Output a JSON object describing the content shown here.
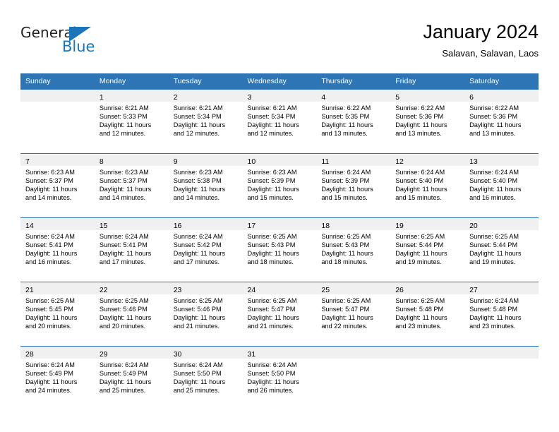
{
  "brand": {
    "name_top": "General",
    "name_bottom": "Blue",
    "triangle_color": "#1b75bb",
    "text_color": "#231f20"
  },
  "header": {
    "title": "January 2024",
    "subtitle": "Salavan, Salavan, Laos"
  },
  "theme": {
    "header_blue": "#2e75b6",
    "daynum_band": "#f0f0f0",
    "text": "#000000"
  },
  "weekdays": [
    "Sunday",
    "Monday",
    "Tuesday",
    "Wednesday",
    "Thursday",
    "Friday",
    "Saturday"
  ],
  "weeks": [
    [
      {
        "day": "",
        "sunrise": "",
        "sunset": "",
        "daylight1": "",
        "daylight2": ""
      },
      {
        "day": "1",
        "sunrise": "Sunrise: 6:21 AM",
        "sunset": "Sunset: 5:33 PM",
        "daylight1": "Daylight: 11 hours",
        "daylight2": "and 12 minutes."
      },
      {
        "day": "2",
        "sunrise": "Sunrise: 6:21 AM",
        "sunset": "Sunset: 5:34 PM",
        "daylight1": "Daylight: 11 hours",
        "daylight2": "and 12 minutes."
      },
      {
        "day": "3",
        "sunrise": "Sunrise: 6:21 AM",
        "sunset": "Sunset: 5:34 PM",
        "daylight1": "Daylight: 11 hours",
        "daylight2": "and 12 minutes."
      },
      {
        "day": "4",
        "sunrise": "Sunrise: 6:22 AM",
        "sunset": "Sunset: 5:35 PM",
        "daylight1": "Daylight: 11 hours",
        "daylight2": "and 13 minutes."
      },
      {
        "day": "5",
        "sunrise": "Sunrise: 6:22 AM",
        "sunset": "Sunset: 5:36 PM",
        "daylight1": "Daylight: 11 hours",
        "daylight2": "and 13 minutes."
      },
      {
        "day": "6",
        "sunrise": "Sunrise: 6:22 AM",
        "sunset": "Sunset: 5:36 PM",
        "daylight1": "Daylight: 11 hours",
        "daylight2": "and 13 minutes."
      }
    ],
    [
      {
        "day": "7",
        "sunrise": "Sunrise: 6:23 AM",
        "sunset": "Sunset: 5:37 PM",
        "daylight1": "Daylight: 11 hours",
        "daylight2": "and 14 minutes."
      },
      {
        "day": "8",
        "sunrise": "Sunrise: 6:23 AM",
        "sunset": "Sunset: 5:37 PM",
        "daylight1": "Daylight: 11 hours",
        "daylight2": "and 14 minutes."
      },
      {
        "day": "9",
        "sunrise": "Sunrise: 6:23 AM",
        "sunset": "Sunset: 5:38 PM",
        "daylight1": "Daylight: 11 hours",
        "daylight2": "and 14 minutes."
      },
      {
        "day": "10",
        "sunrise": "Sunrise: 6:23 AM",
        "sunset": "Sunset: 5:39 PM",
        "daylight1": "Daylight: 11 hours",
        "daylight2": "and 15 minutes."
      },
      {
        "day": "11",
        "sunrise": "Sunrise: 6:24 AM",
        "sunset": "Sunset: 5:39 PM",
        "daylight1": "Daylight: 11 hours",
        "daylight2": "and 15 minutes."
      },
      {
        "day": "12",
        "sunrise": "Sunrise: 6:24 AM",
        "sunset": "Sunset: 5:40 PM",
        "daylight1": "Daylight: 11 hours",
        "daylight2": "and 15 minutes."
      },
      {
        "day": "13",
        "sunrise": "Sunrise: 6:24 AM",
        "sunset": "Sunset: 5:40 PM",
        "daylight1": "Daylight: 11 hours",
        "daylight2": "and 16 minutes."
      }
    ],
    [
      {
        "day": "14",
        "sunrise": "Sunrise: 6:24 AM",
        "sunset": "Sunset: 5:41 PM",
        "daylight1": "Daylight: 11 hours",
        "daylight2": "and 16 minutes."
      },
      {
        "day": "15",
        "sunrise": "Sunrise: 6:24 AM",
        "sunset": "Sunset: 5:41 PM",
        "daylight1": "Daylight: 11 hours",
        "daylight2": "and 17 minutes."
      },
      {
        "day": "16",
        "sunrise": "Sunrise: 6:24 AM",
        "sunset": "Sunset: 5:42 PM",
        "daylight1": "Daylight: 11 hours",
        "daylight2": "and 17 minutes."
      },
      {
        "day": "17",
        "sunrise": "Sunrise: 6:25 AM",
        "sunset": "Sunset: 5:43 PM",
        "daylight1": "Daylight: 11 hours",
        "daylight2": "and 18 minutes."
      },
      {
        "day": "18",
        "sunrise": "Sunrise: 6:25 AM",
        "sunset": "Sunset: 5:43 PM",
        "daylight1": "Daylight: 11 hours",
        "daylight2": "and 18 minutes."
      },
      {
        "day": "19",
        "sunrise": "Sunrise: 6:25 AM",
        "sunset": "Sunset: 5:44 PM",
        "daylight1": "Daylight: 11 hours",
        "daylight2": "and 19 minutes."
      },
      {
        "day": "20",
        "sunrise": "Sunrise: 6:25 AM",
        "sunset": "Sunset: 5:44 PM",
        "daylight1": "Daylight: 11 hours",
        "daylight2": "and 19 minutes."
      }
    ],
    [
      {
        "day": "21",
        "sunrise": "Sunrise: 6:25 AM",
        "sunset": "Sunset: 5:45 PM",
        "daylight1": "Daylight: 11 hours",
        "daylight2": "and 20 minutes."
      },
      {
        "day": "22",
        "sunrise": "Sunrise: 6:25 AM",
        "sunset": "Sunset: 5:46 PM",
        "daylight1": "Daylight: 11 hours",
        "daylight2": "and 20 minutes."
      },
      {
        "day": "23",
        "sunrise": "Sunrise: 6:25 AM",
        "sunset": "Sunset: 5:46 PM",
        "daylight1": "Daylight: 11 hours",
        "daylight2": "and 21 minutes."
      },
      {
        "day": "24",
        "sunrise": "Sunrise: 6:25 AM",
        "sunset": "Sunset: 5:47 PM",
        "daylight1": "Daylight: 11 hours",
        "daylight2": "and 21 minutes."
      },
      {
        "day": "25",
        "sunrise": "Sunrise: 6:25 AM",
        "sunset": "Sunset: 5:47 PM",
        "daylight1": "Daylight: 11 hours",
        "daylight2": "and 22 minutes."
      },
      {
        "day": "26",
        "sunrise": "Sunrise: 6:25 AM",
        "sunset": "Sunset: 5:48 PM",
        "daylight1": "Daylight: 11 hours",
        "daylight2": "and 23 minutes."
      },
      {
        "day": "27",
        "sunrise": "Sunrise: 6:24 AM",
        "sunset": "Sunset: 5:48 PM",
        "daylight1": "Daylight: 11 hours",
        "daylight2": "and 23 minutes."
      }
    ],
    [
      {
        "day": "28",
        "sunrise": "Sunrise: 6:24 AM",
        "sunset": "Sunset: 5:49 PM",
        "daylight1": "Daylight: 11 hours",
        "daylight2": "and 24 minutes."
      },
      {
        "day": "29",
        "sunrise": "Sunrise: 6:24 AM",
        "sunset": "Sunset: 5:49 PM",
        "daylight1": "Daylight: 11 hours",
        "daylight2": "and 25 minutes."
      },
      {
        "day": "30",
        "sunrise": "Sunrise: 6:24 AM",
        "sunset": "Sunset: 5:50 PM",
        "daylight1": "Daylight: 11 hours",
        "daylight2": "and 25 minutes."
      },
      {
        "day": "31",
        "sunrise": "Sunrise: 6:24 AM",
        "sunset": "Sunset: 5:50 PM",
        "daylight1": "Daylight: 11 hours",
        "daylight2": "and 26 minutes."
      },
      {
        "day": "",
        "sunrise": "",
        "sunset": "",
        "daylight1": "",
        "daylight2": ""
      },
      {
        "day": "",
        "sunrise": "",
        "sunset": "",
        "daylight1": "",
        "daylight2": ""
      },
      {
        "day": "",
        "sunrise": "",
        "sunset": "",
        "daylight1": "",
        "daylight2": ""
      }
    ]
  ]
}
